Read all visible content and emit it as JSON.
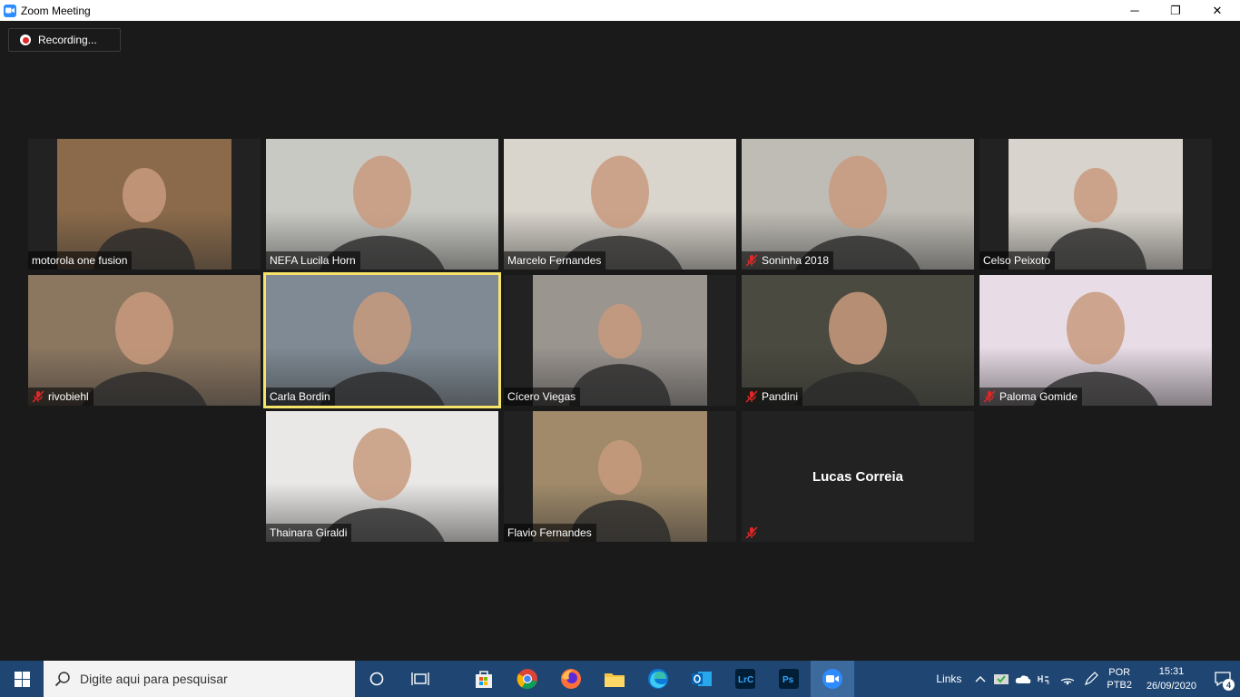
{
  "window": {
    "title": "Zoom Meeting",
    "controls": {
      "minimize": "─",
      "restore": "❐",
      "close": "✕"
    }
  },
  "recording": {
    "label": "Recording..."
  },
  "participants": [
    {
      "name": "motorola one fusion",
      "muted": false,
      "scene": "#8a6a4a"
    },
    {
      "name": "NEFA Lucila Horn",
      "muted": false,
      "scene": "#c9c9c4"
    },
    {
      "name": "Marcelo Fernandes",
      "muted": false,
      "scene": "#d9d4cc"
    },
    {
      "name": "Soninha 2018",
      "muted": true,
      "scene": "#bfbcb5"
    },
    {
      "name": "Celso Peixoto",
      "muted": false,
      "scene": "#d8d3cc"
    },
    {
      "name": "rivobiehl",
      "muted": true,
      "scene": "#8b7660"
    },
    {
      "name": "Carla Bordin",
      "muted": false,
      "active": true,
      "scene": "#7f8a94"
    },
    {
      "name": "Cícero Viegas",
      "muted": false,
      "scene": "#9b9590"
    },
    {
      "name": "Pandini",
      "muted": true,
      "scene": "#4a4a40"
    },
    {
      "name": "Paloma Gomide",
      "muted": true,
      "scene": "#e8dce6"
    },
    {
      "name": "Thainara Giraldi",
      "muted": false,
      "scene": "#eae8e6"
    },
    {
      "name": "Flavio Fernandes",
      "muted": false,
      "scene": "#a08a6a"
    },
    {
      "name": "Lucas Correia",
      "muted": true,
      "camera_off": true
    }
  ],
  "taskbar": {
    "search_placeholder": "Digite aqui para pesquisar",
    "apps": [
      "cortana-icon",
      "task-view-icon",
      "store-icon",
      "chrome-icon",
      "firefox-icon",
      "file-explorer-icon",
      "edge-icon",
      "outlook-icon",
      "lightroom-icon",
      "photoshop-icon",
      "zoom-icon"
    ],
    "links_label": "Links",
    "lang_top": "POR",
    "lang_bottom": "PTB2",
    "time": "15:31",
    "date": "26/09/2020",
    "notification_count": "4"
  }
}
